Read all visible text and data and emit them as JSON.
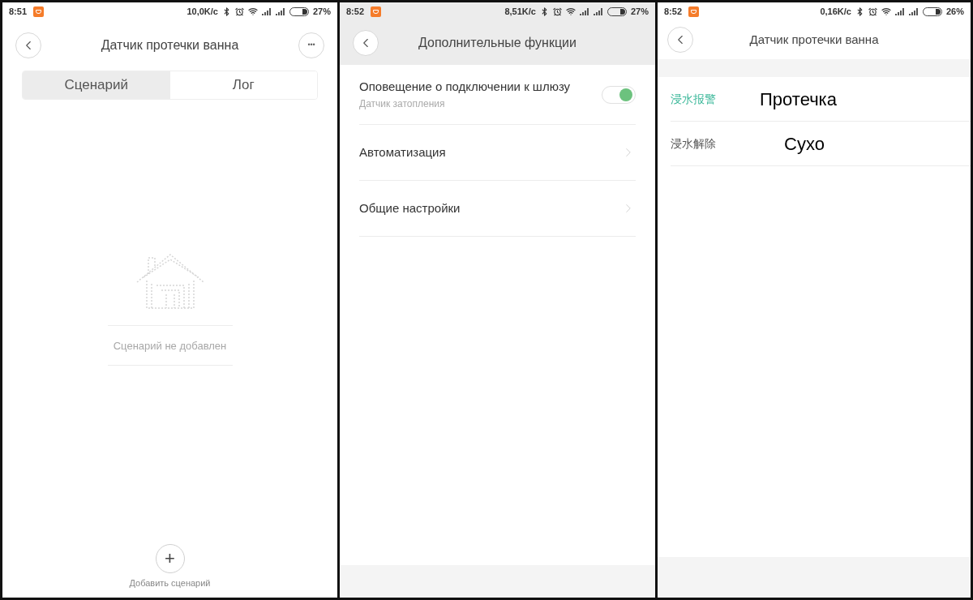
{
  "screens": [
    {
      "kind": "scenes",
      "status_bar": {
        "time": "8:51",
        "speed": "10,0K/с",
        "battery": "27%"
      },
      "header": {
        "title": "Датчик протечки ванна",
        "more": "•••"
      },
      "tabs": [
        {
          "label": "Сценарий",
          "selected": true
        },
        {
          "label": "Лог",
          "selected": false
        }
      ],
      "empty_text": "Сценарий не добавлен",
      "add_button": {
        "icon": "+",
        "label": "Добавить сценарий"
      }
    },
    {
      "kind": "settings",
      "status_bar": {
        "time": "8:52",
        "speed": "8,51K/с",
        "battery": "27%"
      },
      "header": {
        "title": "Дополнительные функции"
      },
      "rows": [
        {
          "kind": "toggle",
          "label": "Оповещение о подключении к шлюзу",
          "sublabel": "Датчик затопления",
          "on": true
        },
        {
          "kind": "nav",
          "label": "Автоматизация"
        },
        {
          "kind": "nav",
          "label": "Общие настройки"
        }
      ]
    },
    {
      "kind": "log",
      "status_bar": {
        "time": "8:52",
        "speed": "0,16K/с",
        "battery": "26%"
      },
      "header": {
        "title": "Датчик протечки ванна"
      },
      "rows": [
        {
          "label": "浸水报警",
          "annotation": "Протечка",
          "selected": true
        },
        {
          "label": "浸水解除",
          "annotation": "Сухо",
          "selected": false
        }
      ]
    }
  ]
}
